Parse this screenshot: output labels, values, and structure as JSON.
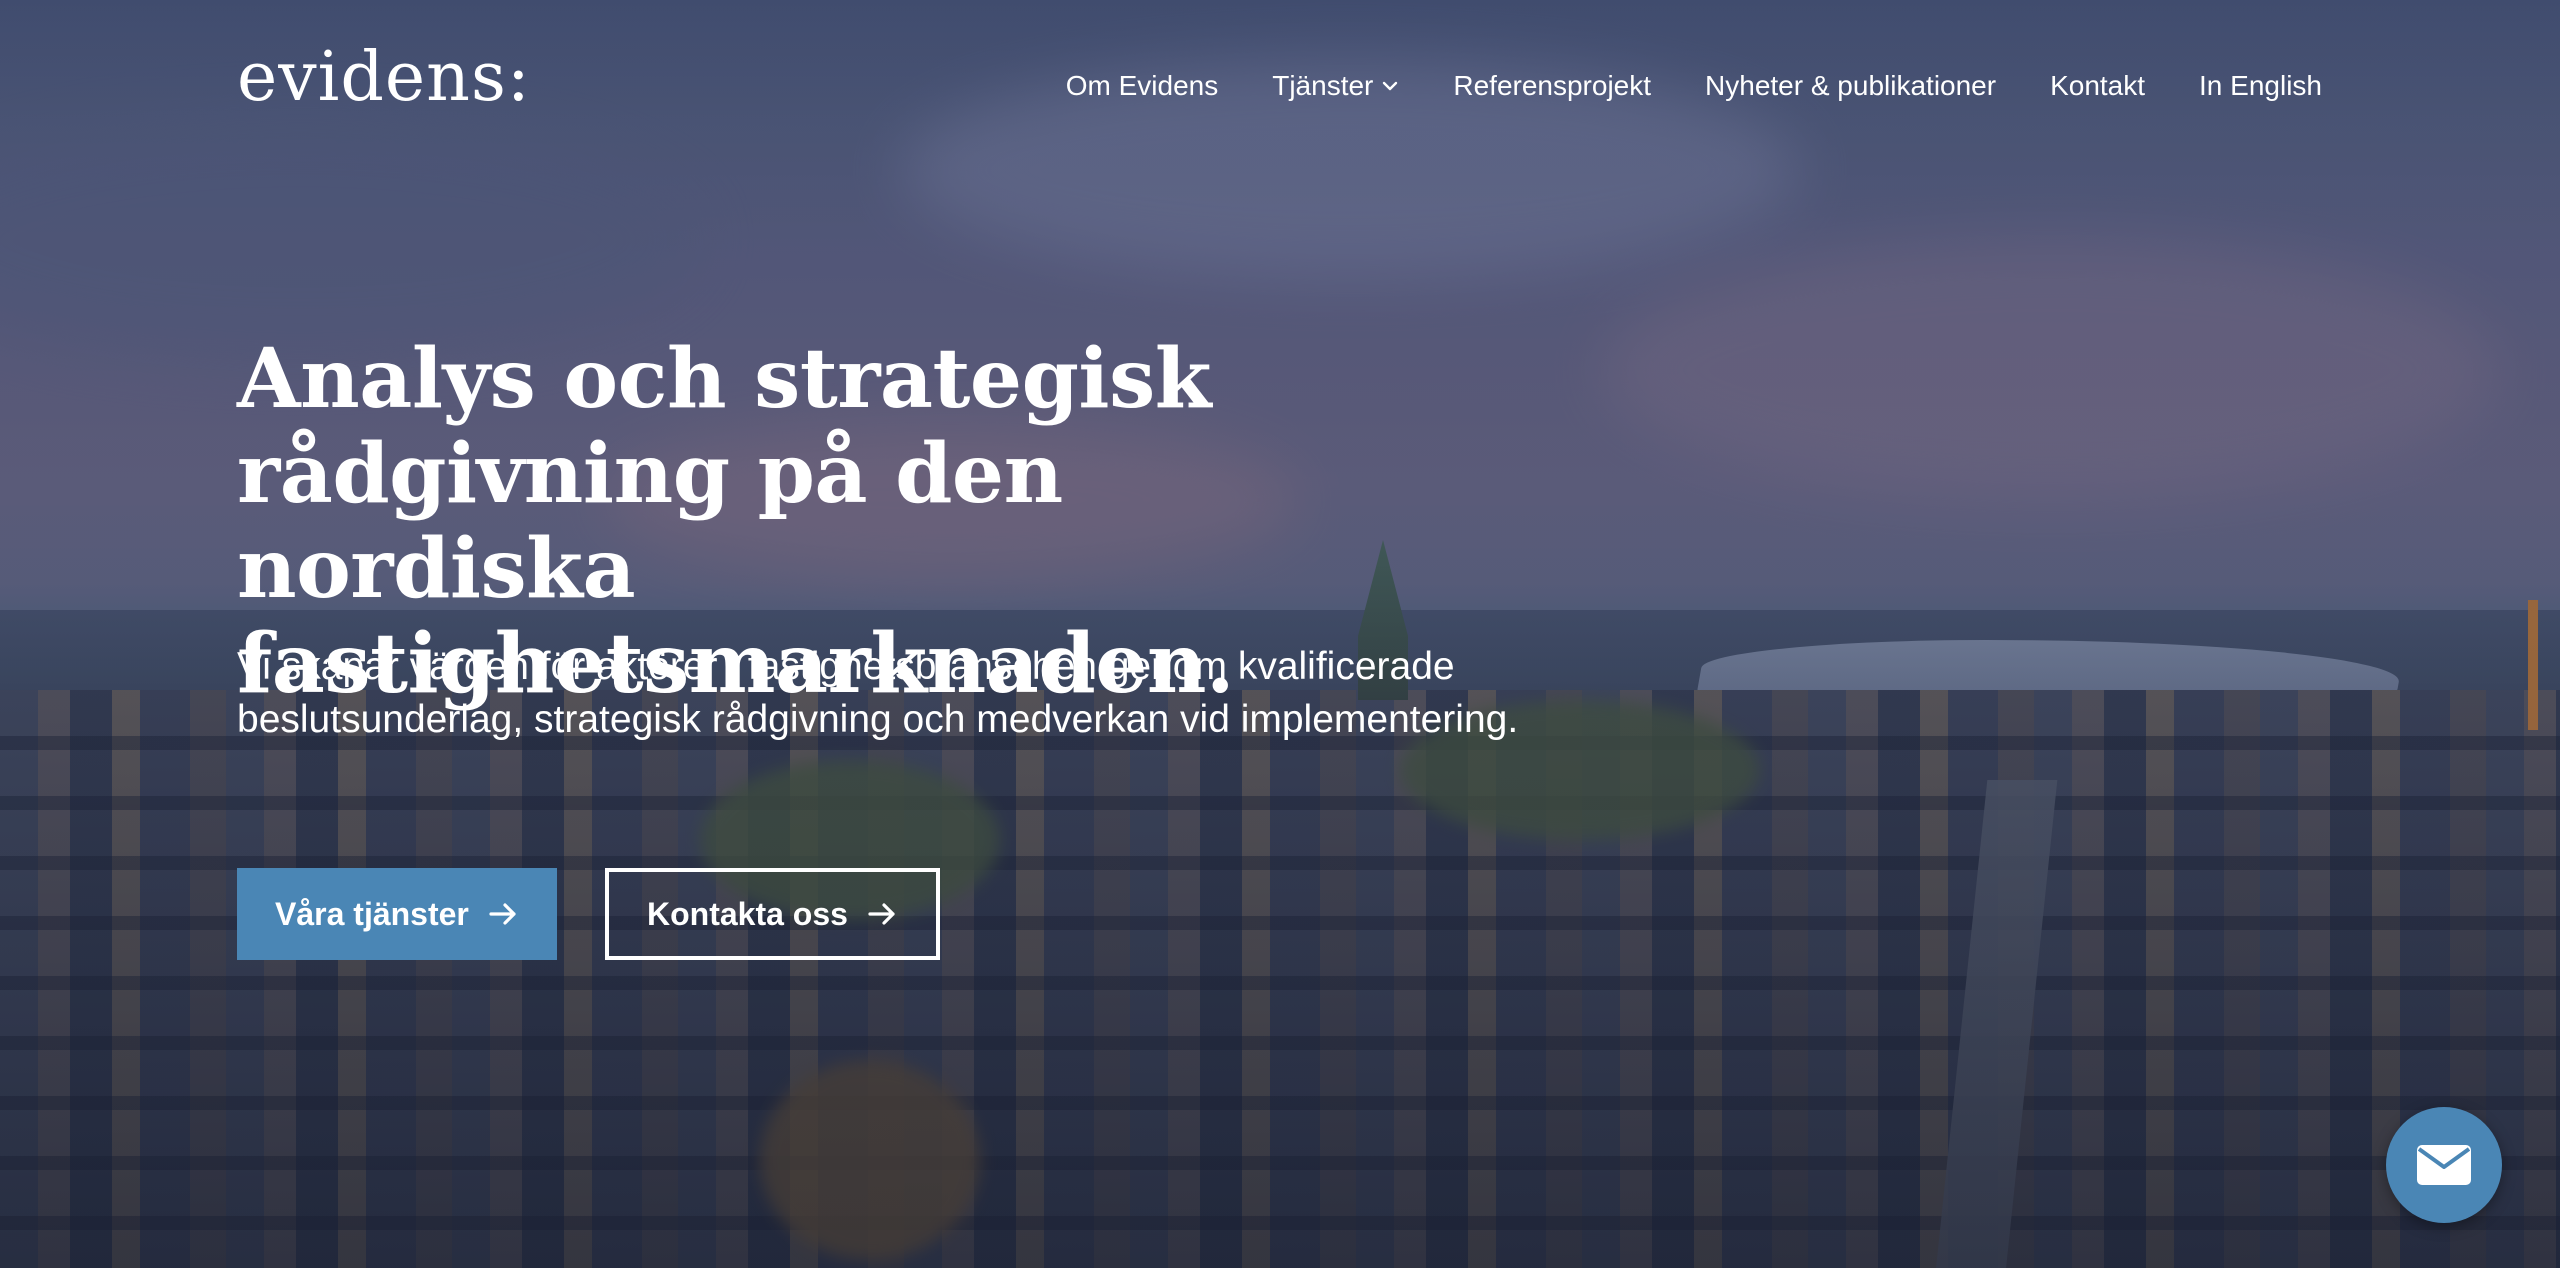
{
  "header": {
    "logo_text": "evidens:",
    "nav": [
      {
        "label": "Om Evidens",
        "has_dropdown": false
      },
      {
        "label": "Tjänster",
        "has_dropdown": true,
        "icon": "chevron-down-icon"
      },
      {
        "label": "Referensprojekt",
        "has_dropdown": false
      },
      {
        "label": "Nyheter & publikationer",
        "has_dropdown": false
      },
      {
        "label": "Kontakt",
        "has_dropdown": false
      },
      {
        "label": "In English",
        "has_dropdown": false
      }
    ]
  },
  "hero": {
    "title": "Analys och strategisk rådgivning på den nordiska fastighetsmarknaden.",
    "lead": "Vi skapar värden för aktörer i fastighetsbranschen genom kvalificerade beslutsunderlag, strategisk rådgivning och medverkan vid implementering.",
    "primary_button": {
      "label": "Våra tjänster",
      "icon": "arrow-right-icon"
    },
    "secondary_button": {
      "label": "Kontakta oss",
      "icon": "arrow-right-icon"
    }
  },
  "fab": {
    "icon": "mail-icon"
  },
  "colors": {
    "accent": "#4a86b5",
    "text": "#ffffff"
  }
}
